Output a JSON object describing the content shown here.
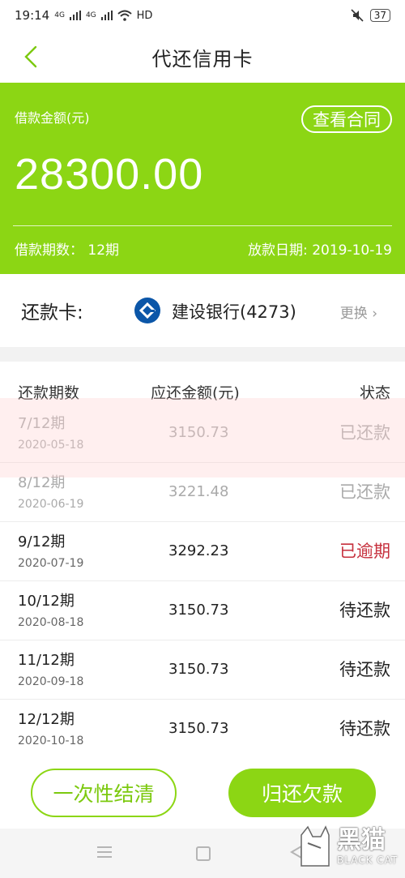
{
  "status_bar": {
    "time": "19:14",
    "network1": "4G",
    "network2": "4G",
    "hd": "HD",
    "battery": "37"
  },
  "nav": {
    "title": "代还信用卡"
  },
  "loan": {
    "amount_label": "借款金额(元)",
    "contract_button": "查看合同",
    "amount": "28300.00",
    "term": "借款期数：  12期",
    "release_date": "放款日期: 2019-10-19"
  },
  "repay_card": {
    "label": "还款卡:",
    "bank": "建设银行(4273)",
    "change": "更换 ›"
  },
  "table": {
    "headers": {
      "period": "还款期数",
      "amount": "应还金额(元)",
      "status": "状态"
    },
    "rows": [
      {
        "period": "7/12期",
        "date": "2020-05-18",
        "amount": "3150.73",
        "status": "已还款"
      },
      {
        "period": "8/12期",
        "date": "2020-06-19",
        "amount": "3221.48",
        "status": "已还款"
      },
      {
        "period": "9/12期",
        "date": "2020-07-19",
        "amount": "3292.23",
        "status": "已逾期"
      },
      {
        "period": "10/12期",
        "date": "2020-08-18",
        "amount": "3150.73",
        "status": "待还款"
      },
      {
        "period": "11/12期",
        "date": "2020-09-18",
        "amount": "3150.73",
        "status": "待还款"
      },
      {
        "period": "12/12期",
        "date": "2020-10-18",
        "amount": "3150.73",
        "status": "待还款"
      }
    ]
  },
  "actions": {
    "settle": "一次性结清",
    "repay": "归还欠款"
  },
  "watermark": {
    "cn": "黑猫",
    "en": "BLACK CAT"
  },
  "colors": {
    "accent": "#8cd614",
    "overdue": "#c62f3c",
    "bank_logo": "#0b56a8"
  }
}
